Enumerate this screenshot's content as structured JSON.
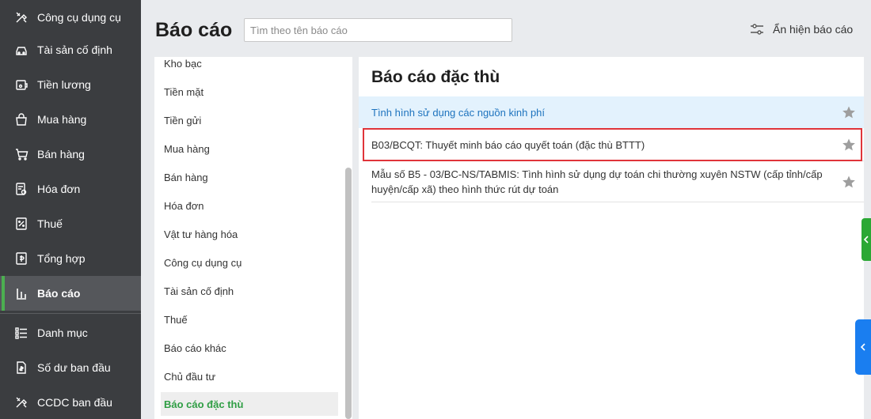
{
  "sidebar": {
    "items": [
      {
        "label": "Công cụ dụng cụ",
        "icon": "tools-icon"
      },
      {
        "label": "Tài sản cố định",
        "icon": "car-icon"
      },
      {
        "label": "Tiền lương",
        "icon": "wallet-icon"
      },
      {
        "label": "Mua hàng",
        "icon": "bag-icon"
      },
      {
        "label": "Bán hàng",
        "icon": "cart-icon"
      },
      {
        "label": "Hóa đơn",
        "icon": "invoice-icon"
      },
      {
        "label": "Thuế",
        "icon": "tax-percent-icon"
      },
      {
        "label": "Tổng hợp",
        "icon": "summary-icon"
      },
      {
        "label": "Báo cáo",
        "icon": "bar-chart-icon",
        "active": true
      },
      {
        "label": "Danh mục",
        "icon": "list-icon"
      },
      {
        "label": "Số dư ban đầu",
        "icon": "balance-doc-icon"
      },
      {
        "label": "CCDC ban đầu",
        "icon": "tools-icon"
      }
    ]
  },
  "header": {
    "title": "Báo cáo",
    "search_placeholder": "Tìm theo tên báo cáo",
    "toggle_label": "Ẩn hiện báo cáo"
  },
  "categories": {
    "items": [
      "Kho bạc",
      "Tiền mặt",
      "Tiền gửi",
      "Mua hàng",
      "Bán hàng",
      "Hóa đơn",
      "Vật tư hàng hóa",
      "Công cụ dụng cụ",
      "Tài sản cố định",
      "Thuế",
      "Báo cáo khác",
      "Chủ đầu tư",
      "Báo cáo đặc thù"
    ],
    "active": "Báo cáo đặc thù"
  },
  "reports": {
    "title": "Báo cáo đặc thù",
    "rows": [
      "Tình hình sử dụng các nguồn kinh phí",
      "B03/BCQT: Thuyết minh báo cáo quyết toán (đặc thù BTTT)",
      "Mẫu số B5 - 03/BC-NS/TABMIS: Tình hình sử dụng dự toán chi thường xuyên NSTW (cấp tỉnh/cấp huyện/cấp xã) theo hình thức rút dự toán"
    ]
  },
  "colors": {
    "sidebar_bg": "#3b3d40",
    "accent_green": "#2f9e44",
    "highlight_blue": "#1e73be",
    "highlight_border": "#e0343a"
  }
}
